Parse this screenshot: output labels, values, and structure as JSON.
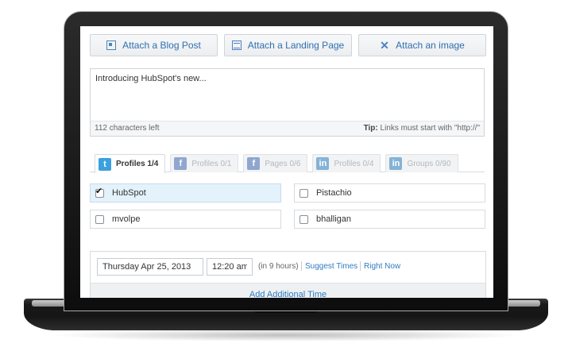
{
  "attach": {
    "blog_post": "Attach a Blog Post",
    "landing_page": "Attach a Landing Page",
    "image": "Attach an image"
  },
  "composer": {
    "text": "Introducing HubSpot's new...",
    "chars_left": "112 characters left",
    "tip_label": "Tip:",
    "tip_text": "Links must start with \"http://\""
  },
  "tabs": [
    {
      "network": "twitter",
      "icon_char": "t",
      "label": "Profiles 1/4",
      "active": true
    },
    {
      "network": "facebook",
      "icon_char": "f",
      "label": "Profiles 0/1",
      "active": false
    },
    {
      "network": "facebook",
      "icon_char": "f",
      "label": "Pages 0/6",
      "active": false
    },
    {
      "network": "linkedin",
      "icon_char": "in",
      "label": "Profiles 0/4",
      "active": false
    },
    {
      "network": "linkedin",
      "icon_char": "in",
      "label": "Groups 0/90",
      "active": false
    }
  ],
  "profiles": [
    {
      "name": "HubSpot",
      "checked": true
    },
    {
      "name": "Pistachio",
      "checked": false
    },
    {
      "name": "mvolpe",
      "checked": false
    },
    {
      "name": "bhalligan",
      "checked": false
    }
  ],
  "schedule": {
    "date": "Thursday Apr 25, 2013",
    "time": "12:20 am",
    "relative": "(in 9 hours)",
    "suggest_times": "Suggest Times",
    "right_now": "Right Now",
    "add_time": "Add Additional Time"
  },
  "colors": {
    "link": "#2f7cc4",
    "twitter": "#3aa0e0",
    "selected_row": "#e3f2fb"
  }
}
